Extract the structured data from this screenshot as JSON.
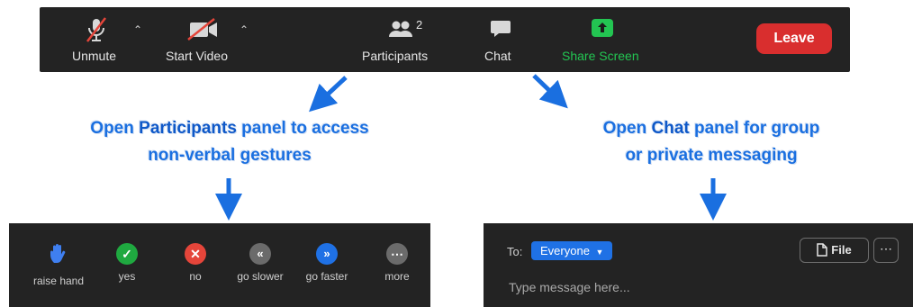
{
  "toolbar": {
    "unmute_label": "Unmute",
    "start_video_label": "Start Video",
    "participants_label": "Participants",
    "participants_count": "2",
    "chat_label": "Chat",
    "share_screen_label": "Share Screen",
    "leave_label": "Leave",
    "colors": {
      "bar": "#232323",
      "share": "#23c552",
      "leave": "#d92e2e"
    }
  },
  "callouts": {
    "participants": {
      "pre": "Open ",
      "bold": "Participants",
      "post": " panel to access",
      "line2": "non-verbal gestures"
    },
    "chat": {
      "pre": "Open ",
      "bold": "Chat",
      "post": " panel for group",
      "line2": "or private messaging"
    },
    "color": "#1a6fe0"
  },
  "reactions": {
    "items": [
      {
        "label": "raise hand",
        "icon": "hand-icon"
      },
      {
        "label": "yes",
        "icon": "check-icon",
        "color": "#1fa940"
      },
      {
        "label": "no",
        "icon": "x-icon",
        "color": "#e5453a"
      },
      {
        "label": "go slower",
        "icon": "rewind-icon",
        "color": "#6b6b6b"
      },
      {
        "label": "go faster",
        "icon": "fast-forward-icon",
        "color": "#1f71e5"
      },
      {
        "label": "more",
        "icon": "more-icon",
        "color": "#6b6b6b"
      }
    ]
  },
  "chat": {
    "to_label": "To:",
    "recipient": "Everyone",
    "file_label": "File",
    "input_placeholder": "Type message here..."
  }
}
